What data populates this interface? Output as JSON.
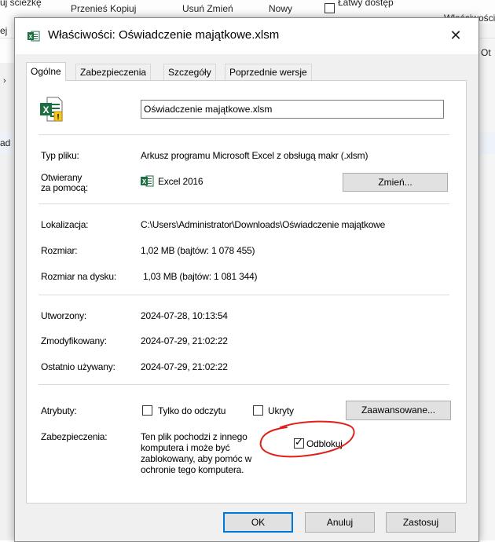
{
  "background": {
    "fragments": [
      {
        "text": "uj ścieżkę"
      },
      {
        "text": "Przenieś  Kopiuj"
      },
      {
        "text": "Usuń   Zmień"
      },
      {
        "text": "Nowy"
      },
      {
        "text": "Łatwy dostęp"
      },
      {
        "text": "Właściwości"
      },
      {
        "text": "Ot"
      },
      {
        "text": "ej"
      },
      {
        "text": "ad"
      },
      {
        "text": "..."
      }
    ]
  },
  "dialog": {
    "title": "Właściwości: Oświadczenie majątkowe.xlsm",
    "close_glyph": "✕",
    "tabs": [
      "Ogólne",
      "Zabezpieczenia",
      "Szczegóły",
      "Poprzednie wersje"
    ],
    "file_name": "Oświadczenie majątkowe.xlsm",
    "type_label": "Typ pliku:",
    "type_value": "Arkusz programu Microsoft Excel z obsługą makr (.xlsm)",
    "opens_label_1": "Otwierany",
    "opens_label_2": "za pomocą:",
    "opens_value": "Excel 2016",
    "change_button": "Zmień...",
    "location_label": "Lokalizacja:",
    "location_value": "C:\\Users\\Administrator\\Downloads\\Oświadczenie majątkowe",
    "size_label": "Rozmiar:",
    "size_value": "1,02 MB (bajtów: 1 078 455)",
    "disk_label": "Rozmiar na dysku:",
    "disk_value": "1,03 MB (bajtów: 1 081 344)",
    "created_label": "Utworzony:",
    "created_value": "2024-07-28, 10:13:54",
    "modified_label": "Zmodyfikowany:",
    "modified_value": "2024-07-29, 21:02:22",
    "accessed_label": "Ostatnio używany:",
    "accessed_value": "2024-07-29, 21:02:22",
    "attributes_label": "Atrybuty:",
    "readonly_label": "Tylko do odczytu",
    "readonly_checked": false,
    "hidden_label": "Ukryty",
    "hidden_checked": false,
    "advanced_button": "Zaawansowane...",
    "security_label": "Zabezpieczenia:",
    "security_text_lines": [
      "Ten plik pochodzi z innego",
      "komputera i może być",
      "zablokowany, aby pomóc w",
      "ochronie tego komputera."
    ],
    "unblock_label": "Odblokuj",
    "unblock_checked": true,
    "ok_button": "OK",
    "cancel_button": "Anuluj",
    "apply_button": "Zastosuj"
  },
  "colors": {
    "excel_green": "#1d6f42",
    "annotation_red": "#e0201b",
    "default_button_border": "#0078d7"
  },
  "icons": [
    "excel-file-icon",
    "excel-app-icon",
    "close-icon",
    "checkbox-icon"
  ]
}
